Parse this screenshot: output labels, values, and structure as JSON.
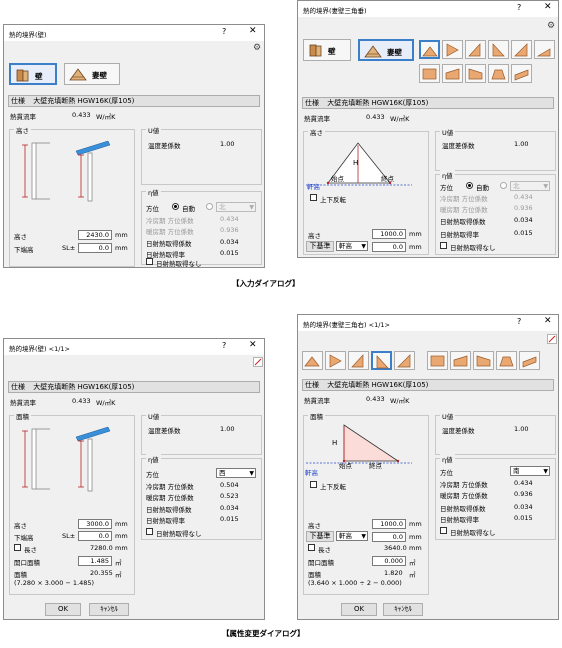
{
  "captions": {
    "input": "【入力ダイアログ】",
    "attr": "【属性変更ダイアログ】"
  },
  "d1": {
    "title": "熱的境界(壁)",
    "help": "?",
    "close": "✕",
    "tab_wall": "壁",
    "tab_gable": "妻壁",
    "spec_label": "仕様",
    "spec_value": "大壁充填断熱 HGW16K(厚105)",
    "flow_label": "熱貫流率",
    "flow_value": "0.433",
    "flow_unit": "W/㎡K",
    "height_group": "高さ",
    "u_group": "U値",
    "temp_label": "温度差係数",
    "temp_value": "1.00",
    "eta_group": "η値",
    "dir_label": "方位",
    "auto_label": "自動",
    "dir_value": "北",
    "cool_label": "冷房期 方位係数",
    "cool_value": "0.434",
    "heat_label": "暖房期 方位係数",
    "heat_value": "0.936",
    "solar_label": "日射熱取得係数",
    "solar_value": "0.034",
    "solar_rate_label": "日射熱取得率",
    "solar_rate_value": "0.015",
    "nosolar_label": "日射熱取得なし",
    "h_label": "高さ",
    "h_value": "2430.0",
    "h_unit": "mm",
    "bottom_label": "下端高",
    "sl_label": "SL±",
    "bottom_value": "0.0",
    "bottom_unit": "mm"
  },
  "d2": {
    "title": "熱的境界(妻壁三角垂)",
    "help": "?",
    "close": "✕",
    "tab_wall": "壁",
    "tab_gable": "妻壁",
    "spec_label": "仕様",
    "spec_value": "大壁充填断熱 HGW16K(厚105)",
    "flow_label": "熱貫流率",
    "flow_value": "0.433",
    "flow_unit": "W/㎡K",
    "height_group": "高さ",
    "u_group": "U値",
    "temp_label": "温度差係数",
    "temp_value": "1.00",
    "eta_group": "η値",
    "dir_label": "方位",
    "auto_label": "自動",
    "dir_value": "北",
    "cool_label": "冷房期 方位係数",
    "cool_value": "0.434",
    "heat_label": "暖房期 方位係数",
    "heat_value": "0.936",
    "solar_label": "日射熱取得係数",
    "solar_value": "0.034",
    "solar_rate_label": "日射熱取得率",
    "solar_rate_value": "0.015",
    "nosolar_label": "日射熱取得なし",
    "h_mark": "H",
    "start_pt": "始点",
    "end_pt": "終点",
    "eave": "軒高",
    "flip_label": "上下反転",
    "h_label": "高さ",
    "h_value": "1000.0",
    "h_unit": "mm",
    "base_label": "下基準",
    "base_value": "軒高",
    "bottom_value": "0.0",
    "bottom_unit": "mm"
  },
  "d3": {
    "title": "熱的境界(壁) <1/1>",
    "help": "?",
    "close": "✕",
    "spec_label": "仕様",
    "spec_value": "大壁充填断熱 HGW16K(厚105)",
    "flow_label": "熱貫流率",
    "flow_value": "0.433",
    "flow_unit": "W/㎡K",
    "area_group": "面積",
    "u_group": "U値",
    "temp_label": "温度差係数",
    "temp_value": "1.00",
    "eta_group": "η値",
    "dir_label": "方位",
    "dir_value": "西",
    "cool_label": "冷房期 方位係数",
    "cool_value": "0.504",
    "heat_label": "暖房期 方位係数",
    "heat_value": "0.523",
    "solar_label": "日射熱取得係数",
    "solar_value": "0.034",
    "solar_rate_label": "日射熱取得率",
    "solar_rate_value": "0.015",
    "nosolar_label": "日射熱取得なし",
    "h_label": "高さ",
    "h_value": "3000.0",
    "h_unit": "mm",
    "bottom_label": "下端高",
    "sl_label": "SL±",
    "bottom_value": "0.0",
    "bottom_unit": "mm",
    "len_label": "長さ",
    "len_value": "7280.0",
    "len_unit": "mm",
    "open_label": "開口面積",
    "open_value": "1.485",
    "open_unit": "㎡",
    "area_label": "面積",
    "area_value": "20.355",
    "area_unit": "㎡",
    "area_formula": "(7.280 × 3.000 − 1.485)",
    "ok": "OK",
    "cancel": "ｷｬﾝｾﾙ"
  },
  "d4": {
    "title": "熱的境界(妻壁三角右) <1/1>",
    "help": "?",
    "close": "✕",
    "spec_label": "仕様",
    "spec_value": "大壁充填断熱 HGW16K(厚105)",
    "flow_label": "熱貫流率",
    "flow_value": "0.433",
    "flow_unit": "W/㎡K",
    "area_group": "面積",
    "u_group": "U値",
    "temp_label": "温度差係数",
    "temp_value": "1.00",
    "eta_group": "η値",
    "dir_label": "方位",
    "dir_value": "南",
    "cool_label": "冷房期 方位係数",
    "cool_value": "0.434",
    "heat_label": "暖房期 方位係数",
    "heat_value": "0.936",
    "solar_label": "日射熱取得係数",
    "solar_value": "0.034",
    "solar_rate_label": "日射熱取得率",
    "solar_rate_value": "0.015",
    "nosolar_label": "日射熱取得なし",
    "h_mark": "H",
    "start_pt": "始点",
    "end_pt": "終点",
    "eave": "軒高",
    "flip_label": "上下反転",
    "h_label": "高さ",
    "h_value": "1000.0",
    "h_unit": "mm",
    "base_label": "下基準",
    "base_value": "軒高",
    "bottom_value": "0.0",
    "bottom_unit": "mm",
    "len_label": "長さ",
    "len_value": "3640.0",
    "len_unit": "mm",
    "open_label": "開口面積",
    "open_value": "0.000",
    "open_unit": "㎡",
    "area_label": "面積",
    "area_value": "1.820",
    "area_unit": "㎡",
    "area_formula": "(3.640 × 1.000 ÷ 2 − 0.000)",
    "ok": "OK",
    "cancel": "ｷｬﾝｾﾙ"
  }
}
